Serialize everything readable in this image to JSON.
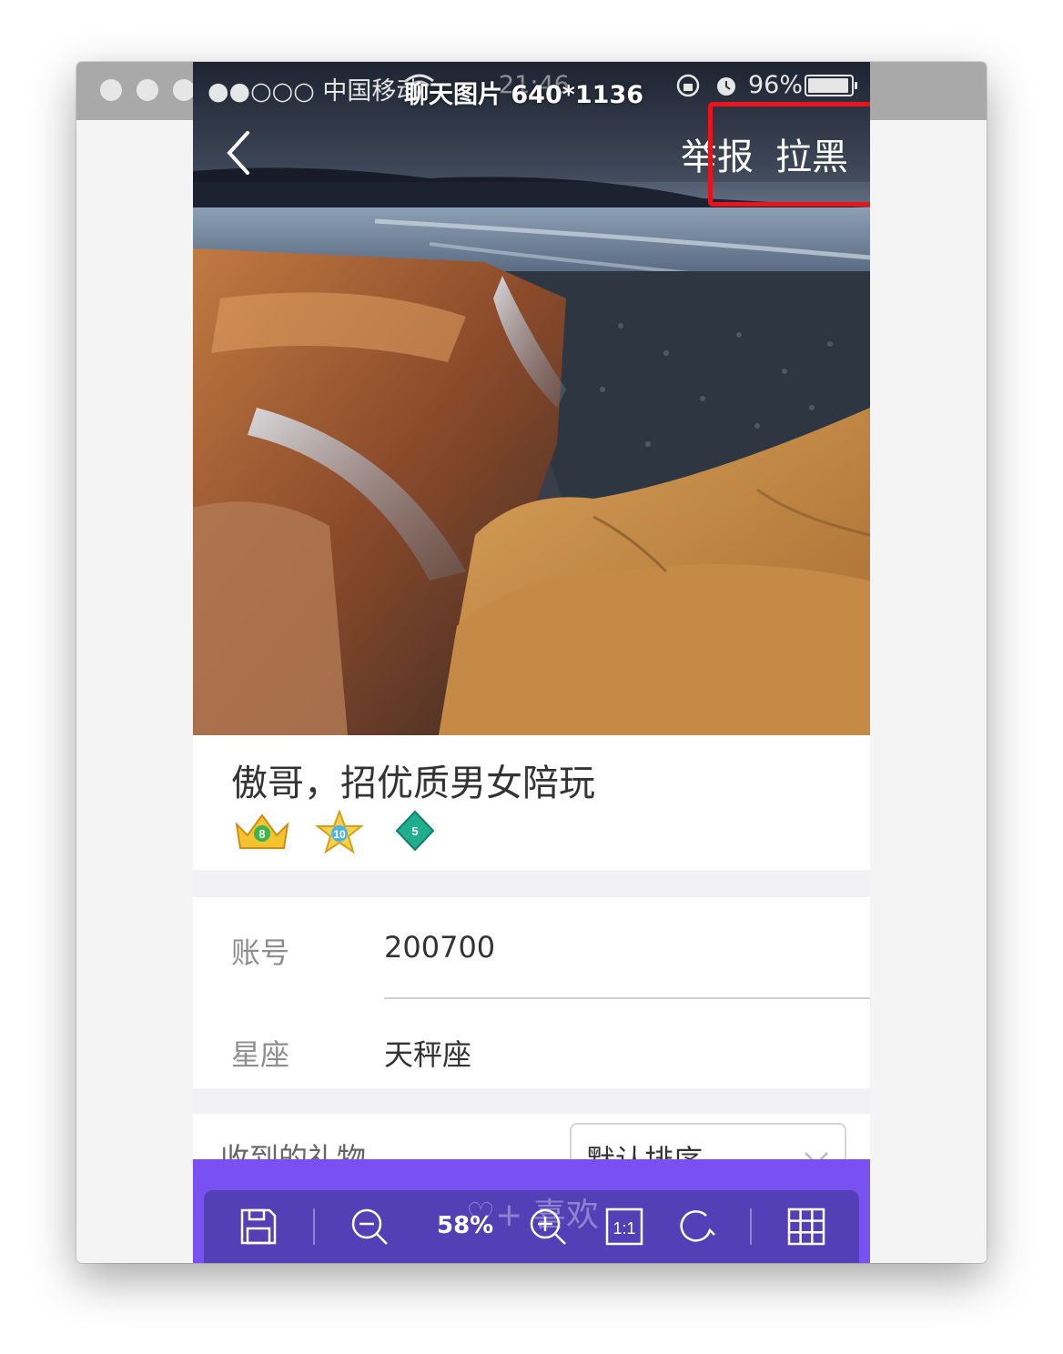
{
  "window": {
    "title": "聊天图片 640*1136"
  },
  "status_bar": {
    "carrier": "●●○○○ 中国移动",
    "time": "21:46",
    "battery_percent": "96%"
  },
  "nav": {
    "back_icon": "chevron-left-icon",
    "report_label": "举报",
    "block_label": "拉黑"
  },
  "profile": {
    "nickname": "傲哥，招优质男女陪玩",
    "badges": [
      {
        "icon": "crown-icon",
        "value": "8"
      },
      {
        "icon": "star-icon",
        "value": "10"
      },
      {
        "icon": "diamond-icon",
        "value": "5"
      }
    ]
  },
  "info": [
    {
      "label": "账号",
      "value": "200700"
    },
    {
      "label": "星座",
      "value": "天秤座"
    }
  ],
  "gifts": {
    "label": "收到的礼物",
    "sort_selected": "默认排序"
  },
  "like_overlay": "♡+ 喜欢",
  "toolbar": {
    "zoom_level": "58%",
    "tools": [
      "save-icon",
      "zoom-out-icon",
      "zoom-in-icon",
      "actual-size-icon",
      "rotate-icon",
      "grid-icon"
    ]
  },
  "colors": {
    "highlight": "#e8131b",
    "toolbar_bg": "#533fb6",
    "purple_bar": "#7950f2"
  }
}
